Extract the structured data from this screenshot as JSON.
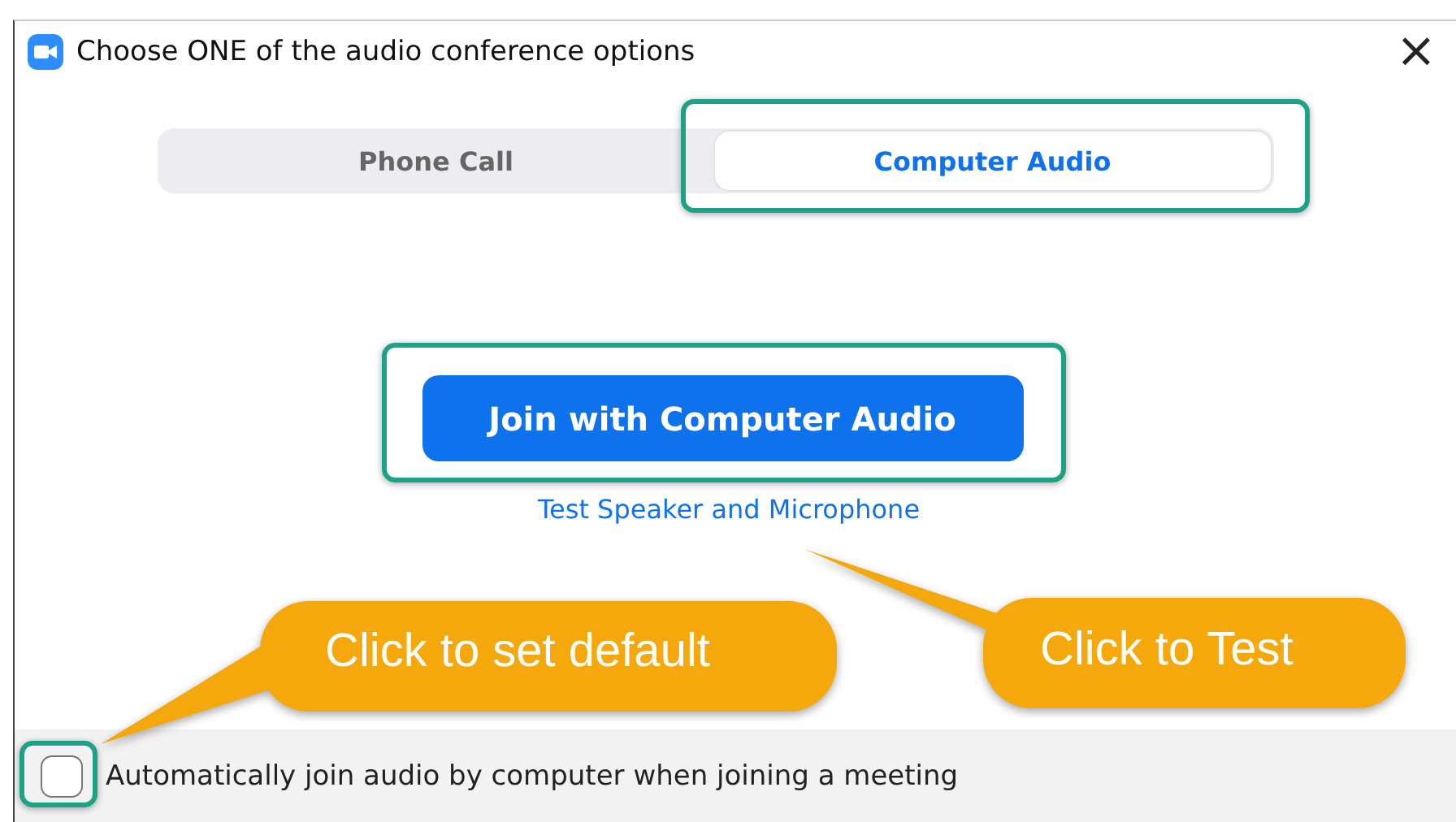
{
  "window": {
    "title": "Choose ONE of the audio conference options",
    "close": "×"
  },
  "tabs": [
    {
      "label": "Phone Call",
      "selected": false,
      "highlighted": false
    },
    {
      "label": "Computer Audio",
      "selected": true,
      "highlighted": true
    }
  ],
  "join_button": {
    "label": "Join with Computer Audio",
    "highlighted": true
  },
  "test_link": "Test Speaker and Microphone",
  "auto_join": {
    "label": "Automatically join audio by computer when joining a meeting",
    "checked": false,
    "highlighted": true
  },
  "callouts": [
    {
      "text": "Click to set default"
    },
    {
      "text": "Click to Test"
    }
  ]
}
